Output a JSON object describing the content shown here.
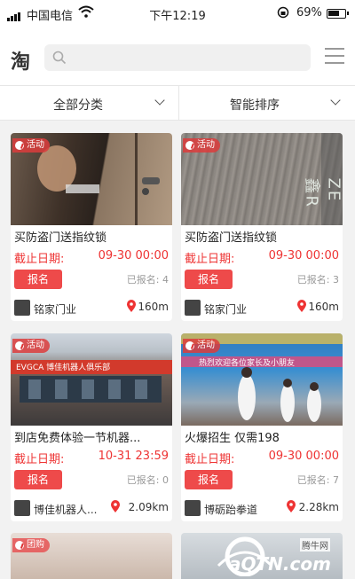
{
  "status_bar": {
    "carrier": "中国电信",
    "time": "下午12:19",
    "battery": "69%"
  },
  "header": {
    "logo": "淘",
    "search_placeholder": ""
  },
  "filters": {
    "category": "全部分类",
    "sort": "智能排序"
  },
  "cards": [
    {
      "tag": "活动",
      "title": "买防盗门送指纹锁",
      "deadline_label": "截止日期:",
      "deadline": "09-30 00:00",
      "signup": "报名",
      "signed": "已报名: 4",
      "shop": "铭家门业",
      "distance": "160m"
    },
    {
      "tag": "活动",
      "title": "买防盗门送指纹锁",
      "deadline_label": "截止日期:",
      "deadline": "09-30 00:00",
      "signup": "报名",
      "signed": "已报名: 3",
      "shop": "铭家门业",
      "distance": "160m"
    },
    {
      "tag": "活动",
      "title": "到店免费体验一节机器...",
      "deadline_label": "截止日期:",
      "deadline": "10-31 23:59",
      "signup": "报名",
      "signed": "已报名: 0",
      "shop": "博佳机器人...",
      "distance": "2.09km"
    },
    {
      "tag": "活动",
      "title": "火爆招生 仅需198",
      "deadline_label": "截止日期:",
      "deadline": "09-30 00:00",
      "signup": "报名",
      "signed": "已报名: 7",
      "shop": "博砺跆拳道",
      "distance": "2.28km"
    }
  ],
  "bottom": {
    "tag": "团购"
  },
  "images": {
    "banner3": "EVGCA 博佳机器人俱乐部",
    "banner4": "热烈欢迎各位家长及小朋友",
    "door_brand": "ZE鑫R"
  },
  "watermark": {
    "text": "aQTN.com",
    "sub": "腾牛网"
  },
  "colors": {
    "accent": "#ee4a4a",
    "deadline": "#e33333"
  }
}
